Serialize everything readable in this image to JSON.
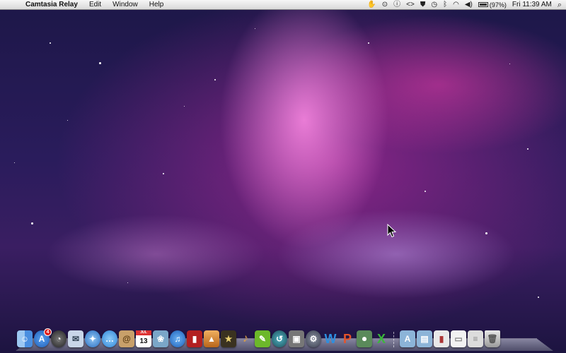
{
  "menubar": {
    "app_name": "Camtasia Relay",
    "items": [
      "Edit",
      "Window",
      "Help"
    ],
    "battery_percent": "(97%)",
    "clock": "Fri 11:39 AM"
  },
  "menubar_icons": [
    "hand-icon",
    "microphone-icon",
    "alert-icon",
    "code-icon",
    "shield-icon",
    "time-machine-icon",
    "bluetooth-icon",
    "wifi-icon",
    "volume-icon",
    "battery-icon",
    "spotlight-search-icon"
  ],
  "dock": {
    "apps": [
      {
        "name": "finder-icon",
        "color": "#4a8fe0"
      },
      {
        "name": "app-store-icon",
        "color": "#3b7fdc",
        "badge": "4"
      },
      {
        "name": "dashboard-icon",
        "color": "#333333"
      },
      {
        "name": "mail-stamp-icon",
        "color": "#c9d6e8"
      },
      {
        "name": "safari-icon",
        "color": "#3a86d8"
      },
      {
        "name": "ichat-icon",
        "color": "#4fa6ea"
      },
      {
        "name": "address-book-icon",
        "color": "#c8a06a"
      },
      {
        "name": "ical-icon",
        "color": "#ffffff",
        "month": "JUL",
        "day": "13"
      },
      {
        "name": "iphoto-icon",
        "color": "#7aa6c8"
      },
      {
        "name": "itunes-icon",
        "color": "#2e7fd6"
      },
      {
        "name": "photo-booth-icon",
        "color": "#b32020"
      },
      {
        "name": "iphoto-library-icon",
        "color": "#d48a2a"
      },
      {
        "name": "imovie-icon",
        "color": "#b0a050"
      },
      {
        "name": "garageband-icon",
        "color": "#d1a040"
      },
      {
        "name": "evernote-icon",
        "color": "#6cb82a"
      },
      {
        "name": "time-machine-icon",
        "color": "#2f6f7f"
      },
      {
        "name": "camtasia-relay-icon",
        "color": "#777777"
      },
      {
        "name": "system-preferences-icon",
        "color": "#5a6070"
      },
      {
        "name": "word-icon",
        "color": "#2d8fe0",
        "letter": "W"
      },
      {
        "name": "powerpoint-icon",
        "color": "#e4532a",
        "letter": "P"
      },
      {
        "name": "relay-recorder-icon",
        "color": "#5a8a5a"
      },
      {
        "name": "excel-icon",
        "color": "#3ab83a",
        "letter": "X"
      }
    ],
    "stacks": [
      {
        "name": "applications-folder-icon",
        "color": "#8cb4d8"
      },
      {
        "name": "documents-folder-icon",
        "color": "#8cb4d8"
      },
      {
        "name": "downloads-stack-icon",
        "color": "#e8e8e8"
      },
      {
        "name": "screenshots-stack-icon",
        "color": "#f2f2f2"
      },
      {
        "name": "files-stack-icon",
        "color": "#dcdcdc"
      },
      {
        "name": "trash-icon",
        "color": "#c8c8c8"
      }
    ]
  }
}
